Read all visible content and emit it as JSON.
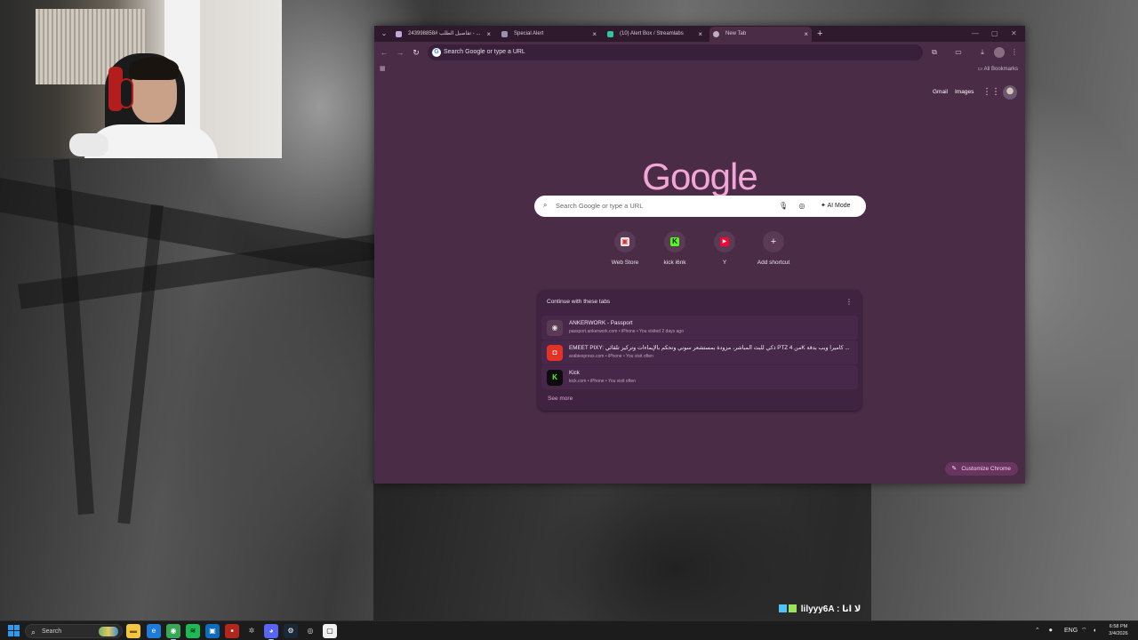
{
  "browser": {
    "tabs": [
      {
        "label": "تفاصيل الطلب #243998858 - ...",
        "active": false
      },
      {
        "label": "Special Alert",
        "active": false
      },
      {
        "label": "(10) Alert Box / Streamlabs",
        "active": false
      },
      {
        "label": "New Tab",
        "active": true
      }
    ],
    "omnibox": {
      "text": "Search Google or type a URL"
    },
    "bookmarks": {
      "all_label": "All Bookmarks"
    }
  },
  "newtab": {
    "links": {
      "gmail": "Gmail",
      "images": "Images"
    },
    "logo": "Google",
    "search": {
      "placeholder": "Search Google or type a URL",
      "ai_mode": "AI Mode"
    },
    "shortcuts": [
      {
        "label": "Web Store",
        "icon": "web-store-icon"
      },
      {
        "label": "kick i6nk",
        "icon": "kick-icon"
      },
      {
        "label": "Y",
        "icon": "youtube-icon"
      },
      {
        "label": "Add shortcut",
        "icon": "plus-icon"
      }
    ],
    "continue": {
      "title": "Continue with these tabs",
      "items": [
        {
          "title": "ANKERWORK - Passport",
          "sub": "passport.ankerwork.com • iPhone • You visited 2 days ago"
        },
        {
          "title": "EMEET PIXY: ذكي للبث المباشر، مزودة بمستشعر سوني وتحكم بالإيماءات وتركيز تلقائي PTZ من 4K كاميرا ويب بدقة ...",
          "sub": "arabiexpress.com • iPhone • You visit often"
        },
        {
          "title": "Kick",
          "sub": "kick.com • iPhone • You visit often"
        }
      ],
      "see_more": "See more"
    },
    "customize": "Customize Chrome"
  },
  "chat": {
    "text": "lilyyy6A : لا انا"
  },
  "taskbar": {
    "search_label": "Search",
    "lang": "ENG",
    "time": "6:58 PM",
    "date": "3/4/2026"
  },
  "colors": {
    "chrome_bg": "#4b2c46",
    "tabbar_bg": "#2e1a2c",
    "logo_pink": "#f2a6d7",
    "accent_pink": "#e6a2d8",
    "kick_green": "#53fc18"
  }
}
